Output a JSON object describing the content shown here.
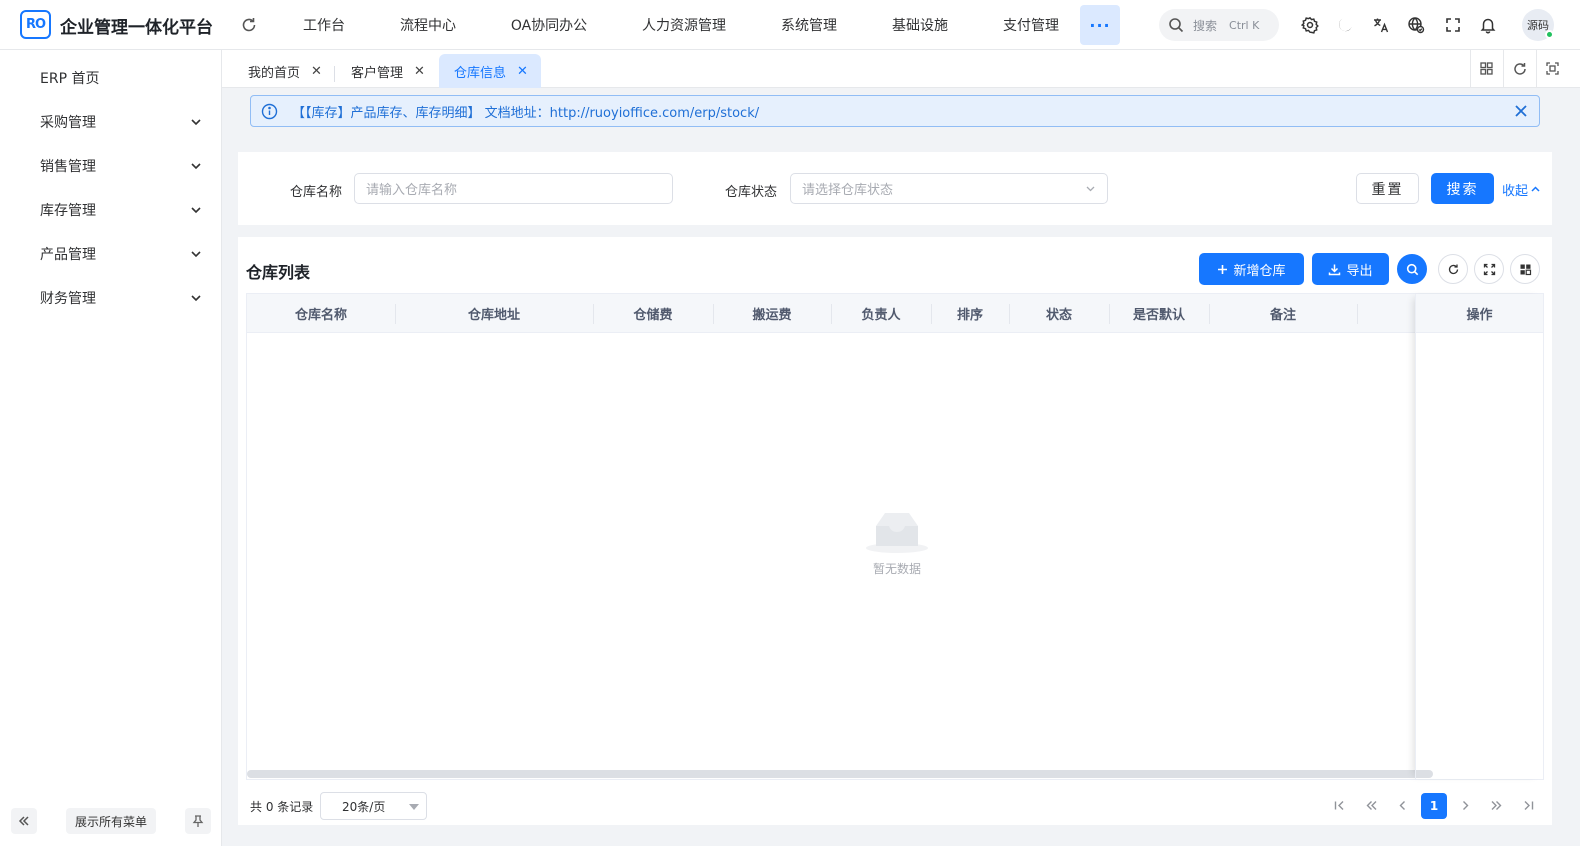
{
  "app": {
    "logo_text": "RO",
    "title": "企业管理一体化平台"
  },
  "top_nav": [
    "工作台",
    "流程中心",
    "OA协同办公",
    "人力资源管理",
    "系统管理",
    "基础设施",
    "支付管理"
  ],
  "top_more_label": "···",
  "global_search": {
    "placeholder": "搜索",
    "shortcut": "Ctrl K"
  },
  "user": {
    "avatar_text": "源码",
    "status_color": "#20c15e"
  },
  "sidebar": {
    "items": [
      "ERP 首页",
      "采购管理",
      "销售管理",
      "库存管理",
      "产品管理",
      "财务管理"
    ],
    "expand_all_label": "展示所有菜单"
  },
  "tabs": [
    {
      "label": "我的首页",
      "active": false
    },
    {
      "label": "客户管理",
      "active": false
    },
    {
      "label": "仓库信息",
      "active": true
    }
  ],
  "alert": {
    "text": "【【库存】产品库存、库存明细】 文档地址：http://ruoyioffice.com/erp/stock/"
  },
  "search_form": {
    "name_label": "仓库名称",
    "name_placeholder": "请输入仓库名称",
    "status_label": "仓库状态",
    "status_placeholder": "请选择仓库状态",
    "reset_label": "重置",
    "search_label": "搜索",
    "collapse_label": "收起"
  },
  "table_card": {
    "title": "仓库列表",
    "add_label": "新增仓库",
    "export_label": "导出",
    "columns": [
      "仓库名称",
      "仓库地址",
      "仓储费",
      "搬运费",
      "负责人",
      "排序",
      "状态",
      "是否默认",
      "备注"
    ],
    "action_column": "操作",
    "empty_text": "暂无数据"
  },
  "pagination": {
    "total_text": "共 0 条记录",
    "page_size": "20条/页",
    "current_page": "1"
  },
  "colors": {
    "primary": "#1677ff",
    "alert_bg": "#e6f0fd",
    "active_tab_bg": "#dbe9ff"
  }
}
